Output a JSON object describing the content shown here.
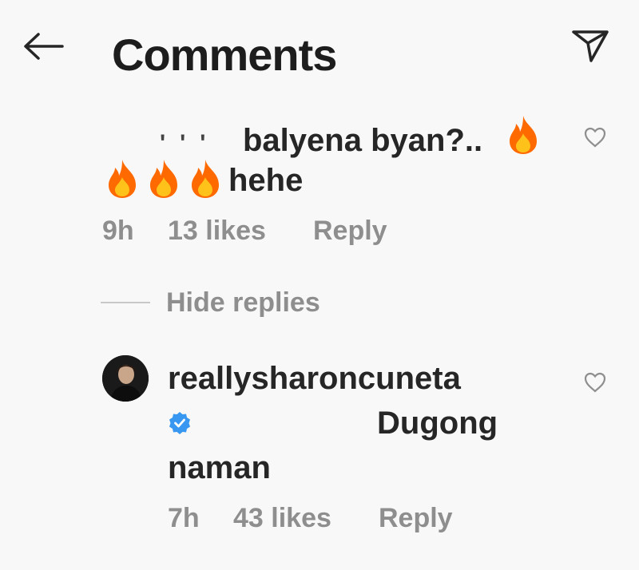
{
  "header": {
    "title": "Comments"
  },
  "comments": [
    {
      "text_line1": "balyena byan?..",
      "text_line2": "hehe",
      "time": "9h",
      "likes": "13 likes",
      "reply": "Reply"
    }
  ],
  "hide_replies": "Hide replies",
  "replies": [
    {
      "username": "reallysharoncuneta",
      "text_line1": "Dugong",
      "text_line2": "naman",
      "time": "7h",
      "likes": "43 likes",
      "reply": "Reply"
    }
  ],
  "colors": {
    "text": "#262626",
    "meta": "#8e8e8e",
    "verified": "#3897f0",
    "fire": "#ff6a00"
  },
  "icons": [
    "back-arrow-icon",
    "send-icon",
    "heart-outline-icon",
    "fire-emoji-icon",
    "verified-badge-icon"
  ]
}
